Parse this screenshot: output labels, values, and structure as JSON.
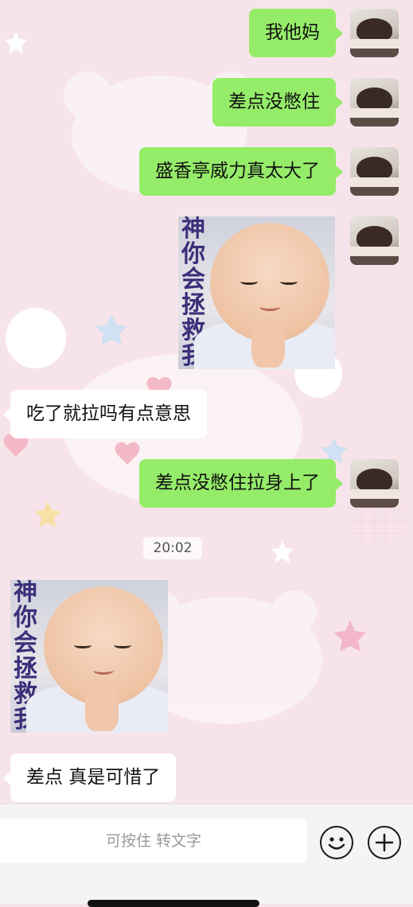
{
  "messages": [
    {
      "sender": "me",
      "type": "text",
      "text": "我他妈"
    },
    {
      "sender": "me",
      "type": "text",
      "text": "差点没憋住"
    },
    {
      "sender": "me",
      "type": "text",
      "text": "盛香亭威力真太大了"
    },
    {
      "sender": "me",
      "type": "sticker",
      "caption": "神你会拯救我吗"
    },
    {
      "sender": "other",
      "type": "text",
      "text": "吃了就拉吗有点意思"
    },
    {
      "sender": "me",
      "type": "text",
      "text": "差点没憋住拉身上了"
    },
    {
      "sender": "other",
      "type": "sticker",
      "caption": "神你会拯救我吗"
    },
    {
      "sender": "other",
      "type": "text",
      "text": "差点 真是可惜了"
    }
  ],
  "timestamp": "20:02",
  "input_bar": {
    "voice_hint": "可按住 转文字",
    "emoji_icon": "emoji-icon",
    "plus_icon": "plus-icon"
  },
  "colors": {
    "my_bubble": "#95ec69",
    "other_bubble": "#ffffff",
    "wallpaper": "#f7e4ea"
  }
}
